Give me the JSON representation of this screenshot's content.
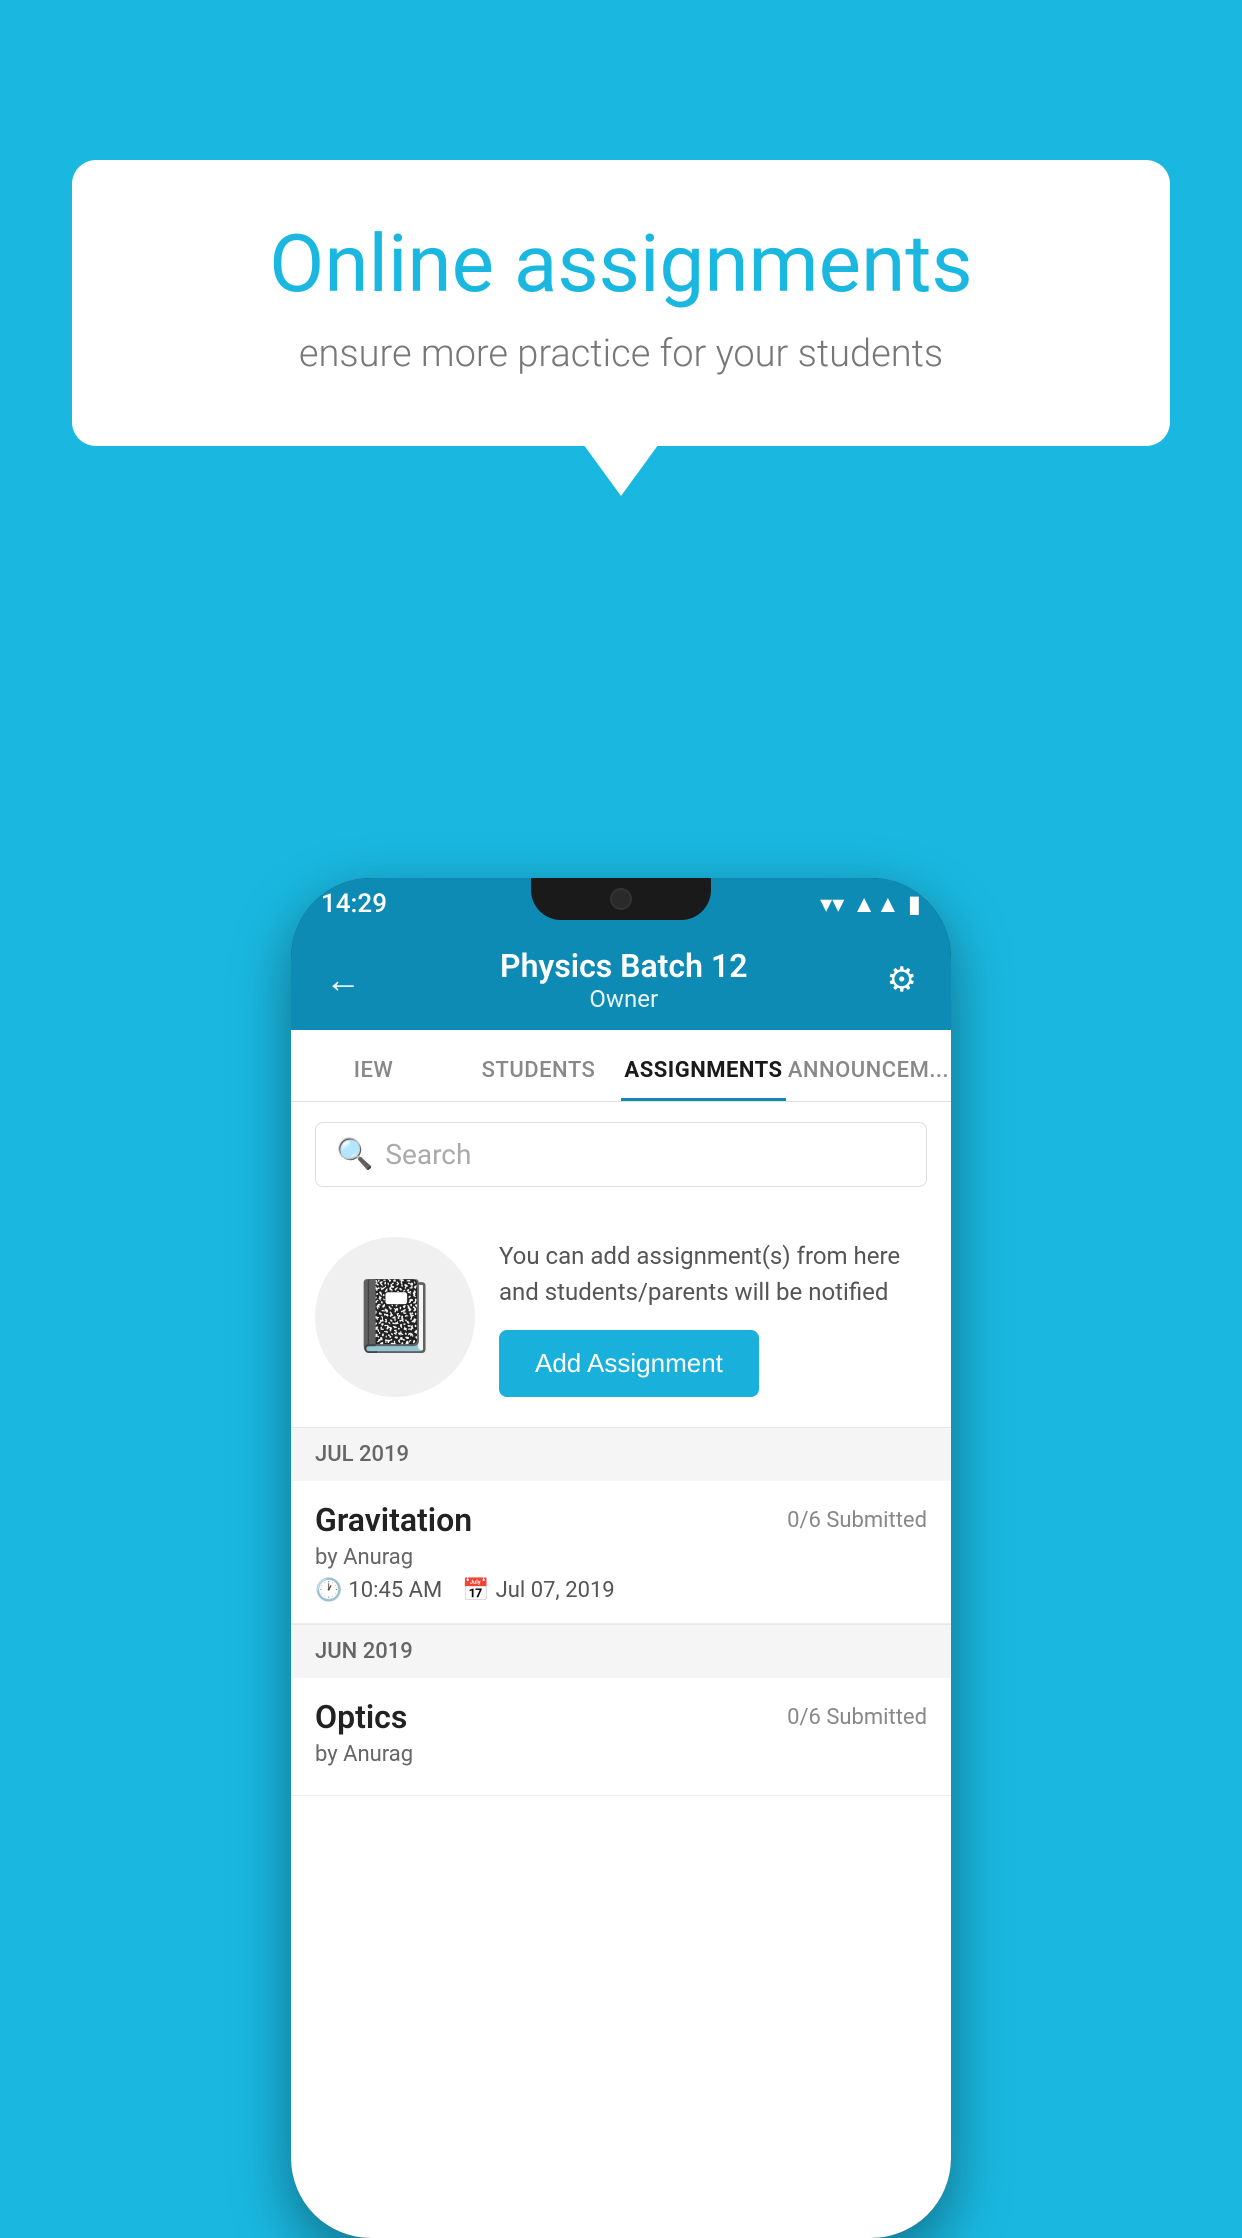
{
  "background": {
    "color": "#1ab8e0"
  },
  "speech_bubble": {
    "title": "Online assignments",
    "subtitle": "ensure more practice for your students"
  },
  "status_bar": {
    "time": "14:29",
    "wifi": "▼",
    "signal": "▲",
    "battery": "▮"
  },
  "app_bar": {
    "back_icon": "←",
    "title": "Physics Batch 12",
    "subtitle": "Owner",
    "settings_icon": "⚙"
  },
  "tabs": [
    {
      "id": "iew",
      "label": "IEW",
      "active": false
    },
    {
      "id": "students",
      "label": "STUDENTS",
      "active": false
    },
    {
      "id": "assignments",
      "label": "ASSIGNMENTS",
      "active": true
    },
    {
      "id": "announcements",
      "label": "ANNOUNCEM...",
      "active": false
    }
  ],
  "search": {
    "placeholder": "Search"
  },
  "add_assignment": {
    "description": "You can add assignment(s) from here and students/parents will be notified",
    "button_label": "Add Assignment"
  },
  "sections": [
    {
      "header": "JUL 2019",
      "items": [
        {
          "name": "Gravitation",
          "submitted": "0/6 Submitted",
          "by": "by Anurag",
          "time": "10:45 AM",
          "date": "Jul 07, 2019"
        }
      ]
    },
    {
      "header": "JUN 2019",
      "items": [
        {
          "name": "Optics",
          "submitted": "0/6 Submitted",
          "by": "by Anurag",
          "time": "",
          "date": ""
        }
      ]
    }
  ]
}
